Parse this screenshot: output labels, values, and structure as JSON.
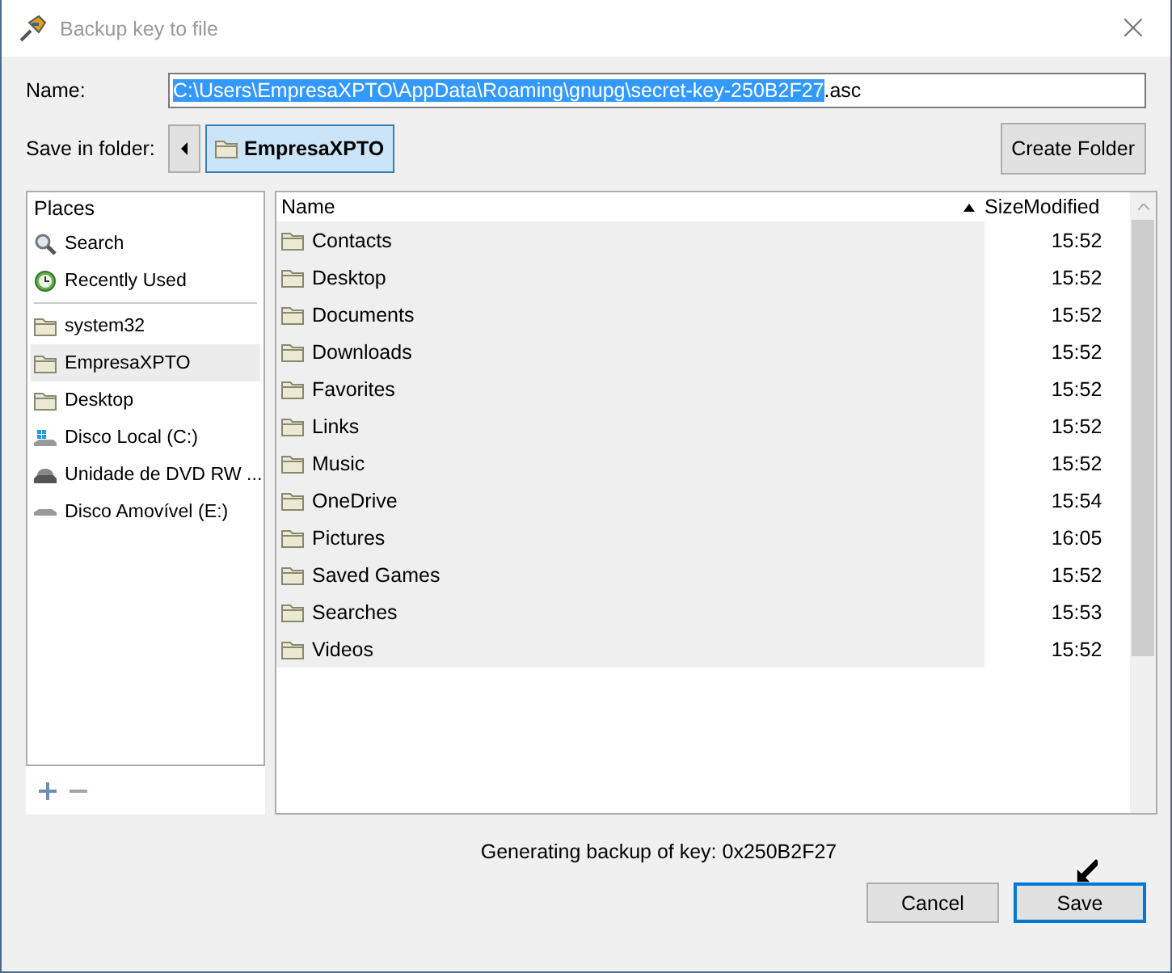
{
  "window": {
    "title": "Backup key to file",
    "close": "×"
  },
  "name_field": {
    "label": "Name:",
    "selected_text": "C:\\Users\\EmpresaXPTO\\AppData\\Roaming\\gnupg\\secret-key-250B2F27",
    "rest_text": ".asc"
  },
  "folder_bar": {
    "label": "Save in folder:",
    "path": [
      {
        "label": "EmpresaXPTO",
        "selected": true
      }
    ],
    "create_button": "Create Folder"
  },
  "places": {
    "header": "Places",
    "groups": [
      [
        {
          "label": "Search",
          "kind": "search",
          "selected": false
        },
        {
          "label": "Recently Used",
          "kind": "recent",
          "selected": false
        }
      ],
      [
        {
          "label": "system32",
          "kind": "folder",
          "selected": false
        },
        {
          "label": "EmpresaXPTO",
          "kind": "folder",
          "selected": true
        },
        {
          "label": "Desktop",
          "kind": "folder",
          "selected": false
        },
        {
          "label": "Disco Local (C:)",
          "kind": "drive",
          "selected": false
        },
        {
          "label": "Unidade de DVD RW ...",
          "kind": "dvd",
          "selected": false
        },
        {
          "label": "Disco Amovível (E:)",
          "kind": "removable",
          "selected": false
        }
      ]
    ]
  },
  "files": {
    "columns": [
      "Name",
      "Size",
      "Modified"
    ],
    "rows": [
      {
        "name": "Contacts",
        "modified": "15:52"
      },
      {
        "name": "Desktop",
        "modified": "15:52"
      },
      {
        "name": "Documents",
        "modified": "15:52"
      },
      {
        "name": "Downloads",
        "modified": "15:52"
      },
      {
        "name": "Favorites",
        "modified": "15:52"
      },
      {
        "name": "Links",
        "modified": "15:52"
      },
      {
        "name": "Music",
        "modified": "15:52"
      },
      {
        "name": "OneDrive",
        "modified": "15:54"
      },
      {
        "name": "Pictures",
        "modified": "16:05"
      },
      {
        "name": "Saved Games",
        "modified": "15:52"
      },
      {
        "name": "Searches",
        "modified": "15:53"
      },
      {
        "name": "Videos",
        "modified": "15:52"
      }
    ]
  },
  "status": "Generating backup of key: 0x250B2F27",
  "buttons": [
    {
      "label": "Cancel",
      "default": false
    },
    {
      "label": "Save",
      "default": true
    }
  ]
}
